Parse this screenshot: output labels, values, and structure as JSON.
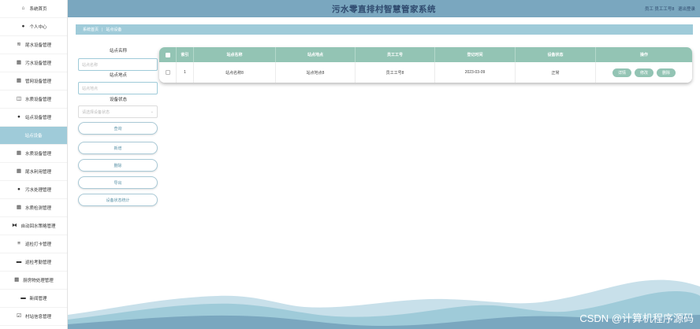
{
  "app": {
    "title": "污水零直排村智慧管家系统"
  },
  "header": {
    "user_label": "员工 员工工号8",
    "logout_label": "退出登录"
  },
  "sidebar": {
    "items": [
      {
        "label": "系统首页",
        "icon": "home-icon",
        "glyph": "⌂"
      },
      {
        "label": "个人中心",
        "icon": "person-icon",
        "glyph": "●"
      },
      {
        "label": "尾水设备管理",
        "icon": "flow-icon",
        "glyph": "≋"
      },
      {
        "label": "污水设备管理",
        "icon": "grid-icon",
        "glyph": "▦"
      },
      {
        "label": "管网设备管理",
        "icon": "grid-icon",
        "glyph": "▦"
      },
      {
        "label": "水质设备管理",
        "icon": "box-icon",
        "glyph": "◫"
      },
      {
        "label": "站点设备管理",
        "icon": "person-icon",
        "glyph": "●"
      },
      {
        "label": "站点设备",
        "icon": "",
        "glyph": "",
        "active": true
      },
      {
        "label": "水质设备管理",
        "icon": "table-icon",
        "glyph": "▦"
      },
      {
        "label": "尾水利用管理",
        "icon": "grid-icon",
        "glyph": "▦"
      },
      {
        "label": "污水处理管理",
        "icon": "person-icon",
        "glyph": "●"
      },
      {
        "label": "水质检测管理",
        "icon": "grid-icon",
        "glyph": "▦"
      },
      {
        "label": "自动回水策略管理",
        "icon": "bowtie-icon",
        "glyph": "⧓"
      },
      {
        "label": "巡检打卡管理",
        "icon": "list-icon",
        "glyph": "≡"
      },
      {
        "label": "巡检考勤管理",
        "icon": "briefcase-icon",
        "glyph": "▬"
      },
      {
        "label": "厨房物处理管理",
        "icon": "grid-icon",
        "glyph": "▦"
      },
      {
        "label": "新闻管理",
        "icon": "message-icon",
        "glyph": "▬"
      },
      {
        "label": "村站信息管理",
        "icon": "check-icon",
        "glyph": "☑"
      }
    ]
  },
  "breadcrumb": {
    "home": "系统首页",
    "separator": "|",
    "current": "站点设备"
  },
  "search": {
    "name_label": "站点名称",
    "name_placeholder": "站点名称",
    "location_label": "站点地点",
    "location_placeholder": "站点地点",
    "status_label": "设备状态",
    "status_placeholder": "请选择设备状态",
    "query_button": "查询"
  },
  "actions": {
    "add": "新增",
    "delete": "删除",
    "export": "导出",
    "stats": "设备状态统计"
  },
  "table": {
    "columns": [
      "索引",
      "站点名称",
      "站点地点",
      "员工工号",
      "登记时间",
      "设备状态",
      "操作"
    ],
    "rows": [
      {
        "index": "1",
        "name": "站点名称8",
        "location": "站点地点8",
        "staff_no": "员工工号8",
        "date": "2023-03-09",
        "status": "正常"
      }
    ],
    "row_buttons": {
      "detail": "详情",
      "edit": "修改",
      "delete": "删除"
    }
  },
  "watermark": "CSDN @计算机程序源码",
  "colors": {
    "header": "#7aa7bf",
    "accent": "#9fcbd9",
    "table_header": "#93c4b4"
  }
}
